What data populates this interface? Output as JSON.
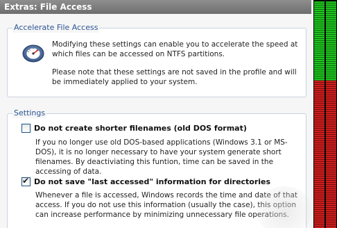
{
  "window": {
    "title": "Extras: File Access"
  },
  "accelerate": {
    "legend": "Accelerate File Access",
    "icon": "speedometer-icon",
    "text1": "Modifying these settings can enable you to accelerate the speed at which files can be accessed on NTFS partitions.",
    "text2": "Please note that these settings are not saved in the profile and will be immediately applied to your system."
  },
  "settings": {
    "legend": "Settings",
    "options": [
      {
        "label": "Do not create shorter filenames (old DOS format)",
        "checked": false,
        "description": "If you no longer use old DOS-based applications (Windows 3.1 or MS-DOS), it is no longer necessary to have your system generate short filenames. By deactiviating this funtion, time can be saved in the accessing of data."
      },
      {
        "label": "Do not save \"last accessed\" information for directories",
        "checked": true,
        "description": "Whenever a file is accessed, Windows records the time and date of that access. If you do not use this information (usually the case), this option can increase performance by minimizing unnecessary file operations."
      }
    ]
  },
  "meter": {
    "level": 0.35,
    "colors": {
      "low": "#1ec31e",
      "high": "#cf1d1d"
    }
  }
}
